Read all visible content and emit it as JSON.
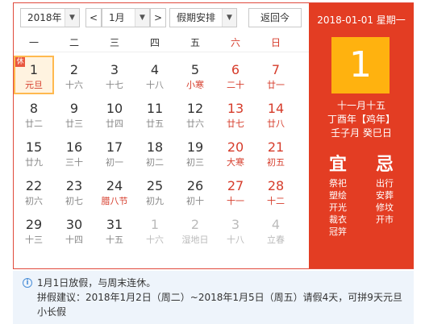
{
  "toolbar": {
    "year": "2018年",
    "prev": "<",
    "month": "1月",
    "next": ">",
    "holiday": "假期安排",
    "today": "返回今"
  },
  "weekdays": [
    {
      "label": "一",
      "weekend": false
    },
    {
      "label": "二",
      "weekend": false
    },
    {
      "label": "三",
      "weekend": false
    },
    {
      "label": "四",
      "weekend": false
    },
    {
      "label": "五",
      "weekend": false
    },
    {
      "label": "六",
      "weekend": true
    },
    {
      "label": "日",
      "weekend": true
    }
  ],
  "days": [
    {
      "n": "1",
      "l": "元旦",
      "w": false,
      "o": false,
      "f": true,
      "today": true,
      "badge": "休"
    },
    {
      "n": "2",
      "l": "十六",
      "w": false,
      "o": false
    },
    {
      "n": "3",
      "l": "十七",
      "w": false,
      "o": false
    },
    {
      "n": "4",
      "l": "十八",
      "w": false,
      "o": false
    },
    {
      "n": "5",
      "l": "小寒",
      "w": false,
      "o": false,
      "f": true
    },
    {
      "n": "6",
      "l": "二十",
      "w": true,
      "o": false
    },
    {
      "n": "7",
      "l": "廿一",
      "w": true,
      "o": false
    },
    {
      "n": "8",
      "l": "廿二",
      "w": false,
      "o": false
    },
    {
      "n": "9",
      "l": "廿三",
      "w": false,
      "o": false
    },
    {
      "n": "10",
      "l": "廿四",
      "w": false,
      "o": false
    },
    {
      "n": "11",
      "l": "廿五",
      "w": false,
      "o": false
    },
    {
      "n": "12",
      "l": "廿六",
      "w": false,
      "o": false
    },
    {
      "n": "13",
      "l": "廿七",
      "w": true,
      "o": false
    },
    {
      "n": "14",
      "l": "廿八",
      "w": true,
      "o": false
    },
    {
      "n": "15",
      "l": "廿九",
      "w": false,
      "o": false
    },
    {
      "n": "16",
      "l": "三十",
      "w": false,
      "o": false
    },
    {
      "n": "17",
      "l": "初一",
      "w": false,
      "o": false
    },
    {
      "n": "18",
      "l": "初二",
      "w": false,
      "o": false
    },
    {
      "n": "19",
      "l": "初三",
      "w": false,
      "o": false
    },
    {
      "n": "20",
      "l": "大寒",
      "w": true,
      "o": false,
      "f": true
    },
    {
      "n": "21",
      "l": "初五",
      "w": true,
      "o": false
    },
    {
      "n": "22",
      "l": "初六",
      "w": false,
      "o": false
    },
    {
      "n": "23",
      "l": "初七",
      "w": false,
      "o": false
    },
    {
      "n": "24",
      "l": "腊八节",
      "w": false,
      "o": false,
      "f": true
    },
    {
      "n": "25",
      "l": "初九",
      "w": false,
      "o": false
    },
    {
      "n": "26",
      "l": "初十",
      "w": false,
      "o": false
    },
    {
      "n": "27",
      "l": "十一",
      "w": true,
      "o": false
    },
    {
      "n": "28",
      "l": "十二",
      "w": true,
      "o": false
    },
    {
      "n": "29",
      "l": "十三",
      "w": false,
      "o": false
    },
    {
      "n": "30",
      "l": "十四",
      "w": false,
      "o": false
    },
    {
      "n": "31",
      "l": "十五",
      "w": false,
      "o": false
    },
    {
      "n": "1",
      "l": "十六",
      "w": false,
      "o": true
    },
    {
      "n": "2",
      "l": "湿地日",
      "w": false,
      "o": true
    },
    {
      "n": "3",
      "l": "十八",
      "w": true,
      "o": true
    },
    {
      "n": "4",
      "l": "立春",
      "w": true,
      "o": true
    }
  ],
  "side": {
    "date_line": "2018-01-01 星期一",
    "day": "1",
    "lunar": "十一月十五",
    "ganzhi_year": "丁酉年【鸡年】",
    "ganzhi_day": "壬子月 癸巳日",
    "yi_label": "宜",
    "ji_label": "忌",
    "yi": [
      "祭祀",
      "塑绘",
      "开光",
      "裁衣",
      "冠笄"
    ],
    "ji": [
      "出行",
      "安葬",
      "修坟",
      "开市"
    ]
  },
  "info": {
    "icon": "info-icon",
    "line1": "1月1日放假，与周末连休。",
    "line2": "拼假建议：2018年1月2日（周二）~2018年1月5日（周五）请假4天，可拼9天元旦小长假"
  },
  "colors": {
    "accent": "#e33d23",
    "today_box": "#ffb20f",
    "weekend_text": "#d63c2b"
  }
}
